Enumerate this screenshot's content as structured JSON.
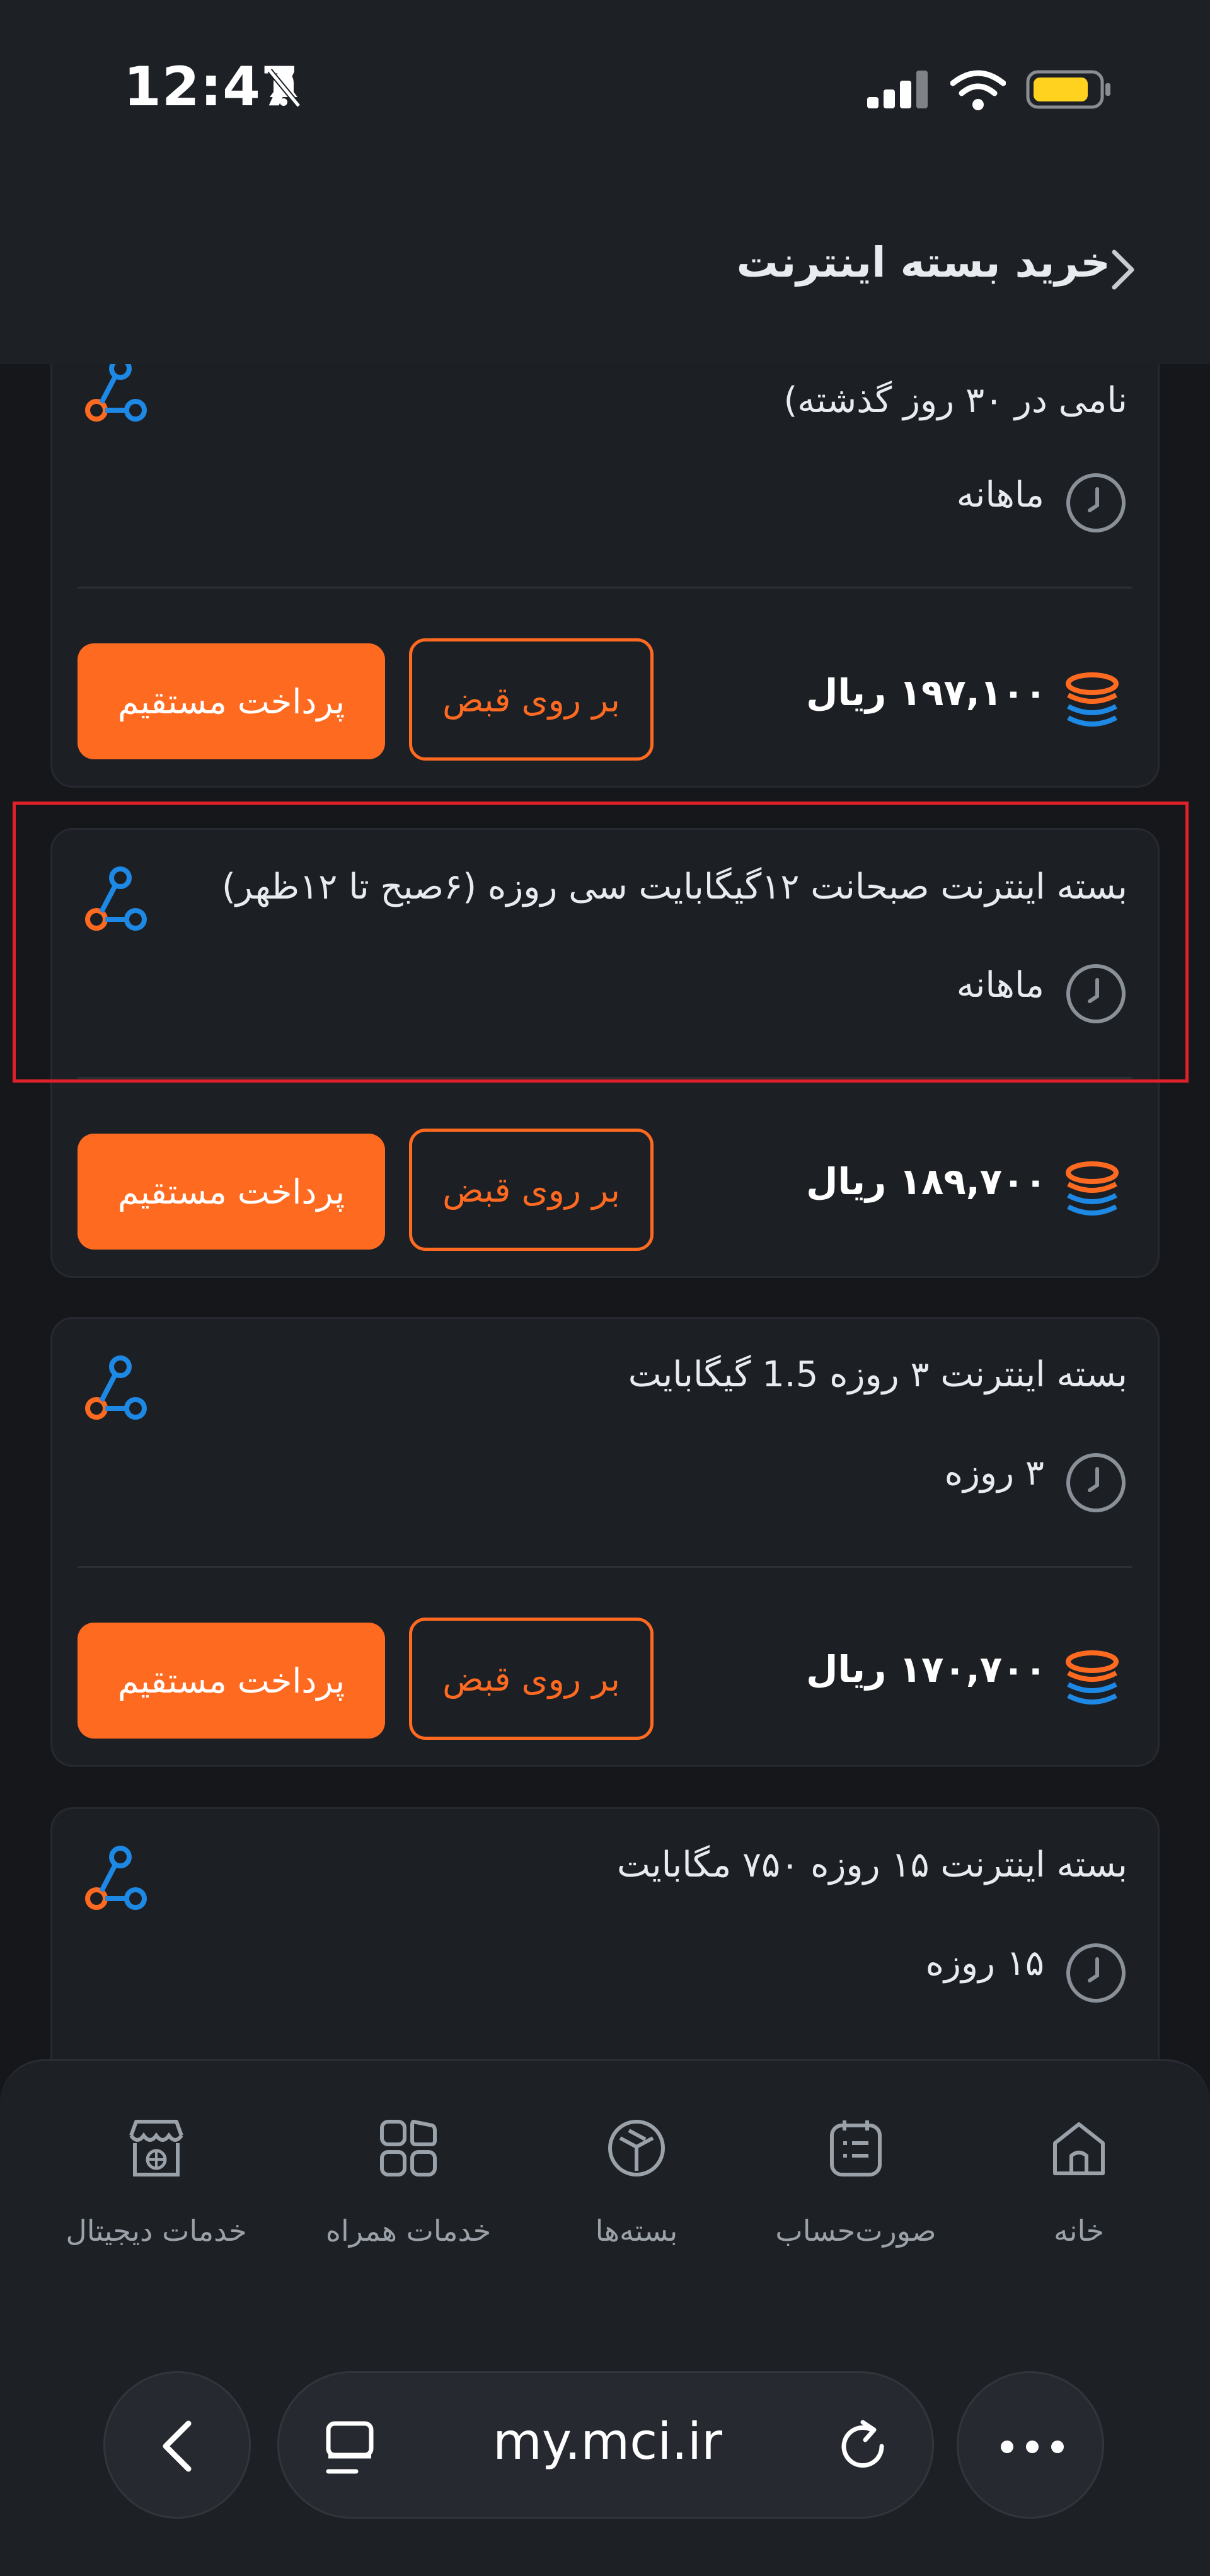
{
  "status_bar": {
    "time": "12:47",
    "icons": [
      "bell-slash-icon",
      "signal-icon",
      "wifi-icon",
      "battery-icon"
    ]
  },
  "header": {
    "title": "خرید بسته اینترنت",
    "back_icon": "chevron-right-icon"
  },
  "packages": [
    {
      "title": "نامی در ۳۰ روز گذشته)",
      "duration": "ماهانه",
      "price": "۱۹۷,۱۰۰ ریال",
      "bill_button": "بر روی قبض",
      "pay_button": "پرداخت مستقیم"
    },
    {
      "title": "بسته اینترنت صبحانت ۱۲گیگابایت سی روزه (۶صبح تا ۱۲ظهر)",
      "duration": "ماهانه",
      "price": "۱۸۹,۷۰۰ ریال",
      "bill_button": "بر روی قبض",
      "pay_button": "پرداخت مستقیم",
      "highlighted": true
    },
    {
      "title": "بسته اینترنت ۳ روزه 1.5 گیگابایت",
      "duration": "۳ روزه",
      "price": "۱۷۰,۷۰۰ ریال",
      "bill_button": "بر روی قبض",
      "pay_button": "پرداخت مستقیم"
    },
    {
      "title": "بسته اینترنت ۱۵ روزه ۷۵۰ مگابایت",
      "duration": "۱۵ روزه"
    }
  ],
  "bottom_nav": {
    "items": [
      {
        "label": "خانه",
        "icon": "home-icon"
      },
      {
        "label": "صورت‌حساب",
        "icon": "bill-icon"
      },
      {
        "label": "بسته‌ها",
        "icon": "package-icon"
      },
      {
        "label": "خدمات همراه",
        "icon": "grid-icon"
      },
      {
        "label": "خدمات دیجیتال",
        "icon": "store-icon"
      }
    ]
  },
  "browser": {
    "url": "my.mci.ir"
  },
  "colors": {
    "accent": "#ff6a21",
    "background": "#15171b",
    "card": "#1c1f24",
    "highlight": "#e0212a",
    "icon_blue": "#1e88e5"
  }
}
